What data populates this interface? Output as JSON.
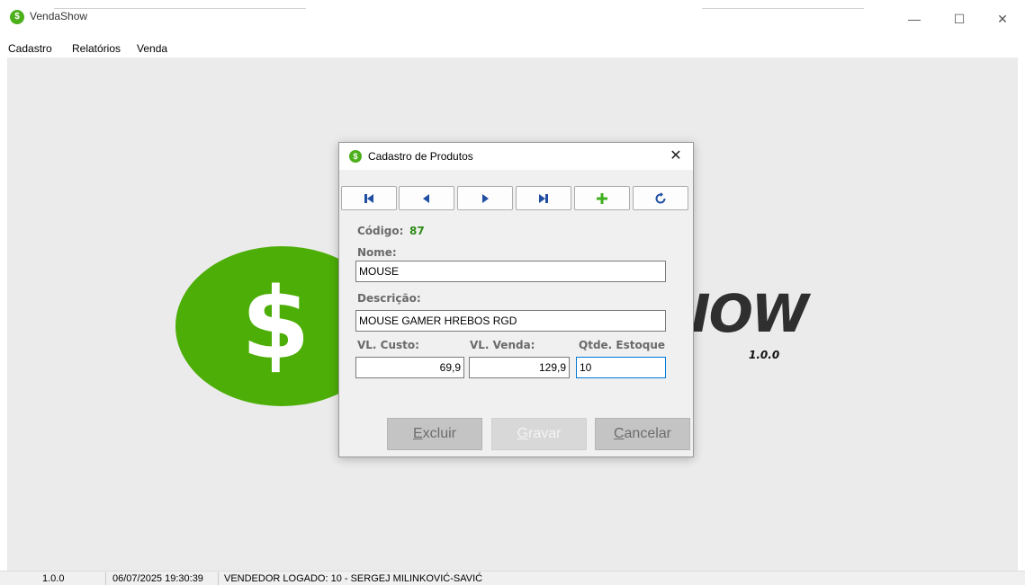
{
  "window": {
    "title": "VendaShow",
    "icon": "dollar-icon",
    "controls": [
      "—",
      "☐",
      "✕"
    ]
  },
  "menu": [
    "Cadastro",
    "Relatórios",
    "Venda"
  ],
  "logo": {
    "symbol": "$",
    "text": "SHOW",
    "visible_text": "IOW",
    "version": "1.0.0"
  },
  "dialog": {
    "title": "Cadastro de Produtos",
    "close": "✕",
    "nav_buttons": [
      {
        "name": "first-record-button",
        "icon": "skip-first-icon"
      },
      {
        "name": "previous-record-button",
        "icon": "previous-icon"
      },
      {
        "name": "next-record-button",
        "icon": "next-icon"
      },
      {
        "name": "last-record-button",
        "icon": "skip-last-icon"
      },
      {
        "name": "add-record-button",
        "icon": "plus-icon"
      },
      {
        "name": "refresh-button",
        "icon": "refresh-icon"
      }
    ],
    "codigo_label": "Código:",
    "codigo_value": "87",
    "nome_label": "Nome:",
    "nome_value": "MOUSE",
    "descricao_label": "Descrição:",
    "descricao_value": "MOUSE GAMER HREBOS RGD",
    "custo_label": "VL. Custo:",
    "custo_value": "69,9",
    "venda_label": "VL. Venda:",
    "venda_value": "129,9",
    "estoque_label": "Qtde. Estoque",
    "estoque_value": "10",
    "excluir": {
      "first": "E",
      "rest": "xcluir"
    },
    "gravar": {
      "first": "G",
      "rest": "ravar"
    },
    "cancelar": {
      "first": "C",
      "rest": "ancelar"
    }
  },
  "status": {
    "version": "1.0.0",
    "datetime": "06/07/2025 19:30:39",
    "user": "VENDEDOR LOGADO: 10 - SERGEJ MILINKOVIĆ-SAVIĆ"
  },
  "colors": {
    "brand_green": "#4cae06",
    "accent_blue": "#1f4ea3",
    "add_green": "#3fae1d",
    "focus_blue": "#0078d7"
  }
}
